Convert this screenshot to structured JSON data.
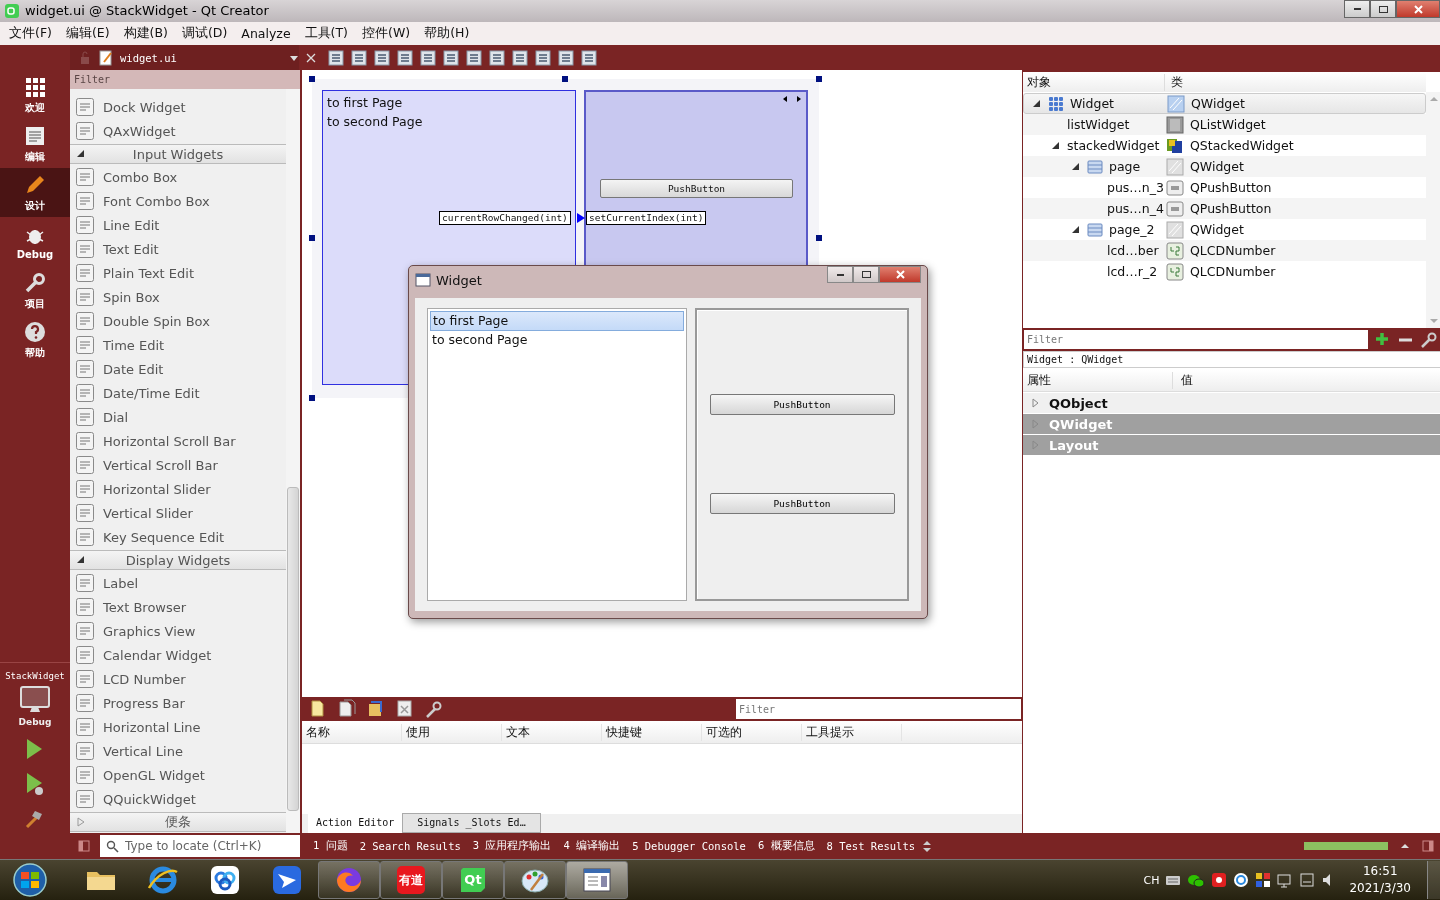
{
  "window": {
    "title": "widget.ui @ StackWidget - Qt Creator"
  },
  "menu": [
    "文件(F)",
    "编辑(E)",
    "构建(B)",
    "调试(D)",
    "Analyze",
    "工具(T)",
    "控件(W)",
    "帮助(H)"
  ],
  "editor_toolbar": {
    "file": "widget.ui"
  },
  "mode_bar": {
    "modes": [
      {
        "label": "欢迎",
        "selected": false
      },
      {
        "label": "编辑",
        "selected": false
      },
      {
        "label": "设计",
        "selected": true
      },
      {
        "label": "Debug",
        "selected": false
      },
      {
        "label": "项目",
        "selected": false
      },
      {
        "label": "帮助",
        "selected": false
      }
    ],
    "target": {
      "project": "StackWidget",
      "config": "Debug"
    }
  },
  "widget_box": {
    "filter": {
      "placeholder": "Filter"
    },
    "items": [
      {
        "kind": "widget",
        "label": "Dock Widget"
      },
      {
        "kind": "widget",
        "label": "QAxWidget"
      },
      {
        "kind": "category",
        "label": "Input Widgets",
        "expanded": true
      },
      {
        "kind": "widget",
        "label": "Combo Box"
      },
      {
        "kind": "widget",
        "label": "Font Combo Box"
      },
      {
        "kind": "widget",
        "label": "Line Edit"
      },
      {
        "kind": "widget",
        "label": "Text Edit"
      },
      {
        "kind": "widget",
        "label": "Plain Text Edit"
      },
      {
        "kind": "widget",
        "label": "Spin Box"
      },
      {
        "kind": "widget",
        "label": "Double Spin Box"
      },
      {
        "kind": "widget",
        "label": "Time Edit"
      },
      {
        "kind": "widget",
        "label": "Date Edit"
      },
      {
        "kind": "widget",
        "label": "Date/Time Edit"
      },
      {
        "kind": "widget",
        "label": "Dial"
      },
      {
        "kind": "widget",
        "label": "Horizontal Scroll Bar"
      },
      {
        "kind": "widget",
        "label": "Vertical Scroll Bar"
      },
      {
        "kind": "widget",
        "label": "Horizontal Slider"
      },
      {
        "kind": "widget",
        "label": "Vertical Slider"
      },
      {
        "kind": "widget",
        "label": "Key Sequence Edit"
      },
      {
        "kind": "category",
        "label": "Display Widgets",
        "expanded": true
      },
      {
        "kind": "widget",
        "label": "Label"
      },
      {
        "kind": "widget",
        "label": "Text Browser"
      },
      {
        "kind": "widget",
        "label": "Graphics View"
      },
      {
        "kind": "widget",
        "label": "Calendar Widget"
      },
      {
        "kind": "widget",
        "label": "LCD Number"
      },
      {
        "kind": "widget",
        "label": "Progress Bar"
      },
      {
        "kind": "widget",
        "label": "Horizontal Line"
      },
      {
        "kind": "widget",
        "label": "Vertical Line"
      },
      {
        "kind": "widget",
        "label": "OpenGL Widget"
      },
      {
        "kind": "widget",
        "label": "QQuickWidget"
      },
      {
        "kind": "category",
        "label": "便条",
        "expanded": false
      }
    ]
  },
  "form": {
    "list_items": [
      "to first Page",
      "to second Page"
    ],
    "button": "PushButton",
    "signal": "currentRowChanged(int)",
    "slot": "setCurrentIndex(int)"
  },
  "preview": {
    "title": "Widget",
    "list_items": [
      {
        "label": "to first Page",
        "selected": true
      },
      {
        "label": "to second Page",
        "selected": false
      }
    ],
    "buttons": [
      "PushButton",
      "PushButton"
    ]
  },
  "object_inspector": {
    "columns": [
      "对象",
      "类"
    ],
    "tree": [
      {
        "name": "Widget",
        "class": "QWidget",
        "kind": "form",
        "selected": true,
        "expanded": true,
        "children": [
          {
            "name": "listWidget",
            "class": "QListWidget",
            "kind": "list",
            "selected": false
          },
          {
            "name": "stackedWidget",
            "class": "QStackedWidget",
            "kind": "stack",
            "selected": false,
            "expanded": true,
            "children": [
              {
                "name": "page",
                "class": "QWidget",
                "kind": "page",
                "selected": false,
                "expanded": true,
                "children": [
                  {
                    "name": "pus…n_3",
                    "class": "QPushButton",
                    "kind": "button",
                    "selected": false
                  },
                  {
                    "name": "pus…n_4",
                    "class": "QPushButton",
                    "kind": "button",
                    "selected": false
                  }
                ]
              },
              {
                "name": "page_2",
                "class": "QWidget",
                "kind": "page",
                "selected": false,
                "expanded": true,
                "children": [
                  {
                    "name": "lcd…ber",
                    "class": "QLCDNumber",
                    "kind": "lcd",
                    "selected": false
                  },
                  {
                    "name": "lcd…r_2",
                    "class": "QLCDNumber",
                    "kind": "lcd",
                    "selected": false
                  }
                ]
              }
            ]
          }
        ]
      }
    ]
  },
  "property_editor": {
    "filter": {
      "placeholder": "Filter"
    },
    "context": "Widget : QWidget",
    "columns": [
      "属性",
      "值"
    ],
    "groups": [
      {
        "label": "QObject",
        "shaded": false,
        "expanded": false
      },
      {
        "label": "QWidget",
        "shaded": true,
        "expanded": false
      },
      {
        "label": "Layout",
        "shaded": true,
        "expanded": false
      }
    ]
  },
  "action_editor": {
    "filter": {
      "placeholder": "Filter"
    },
    "columns": [
      "名称",
      "使用",
      "文本",
      "快捷键",
      "可选的",
      "工具提示"
    ],
    "tabs": [
      {
        "label": "Action Editor",
        "selected": true
      },
      {
        "label": "Signals _Slots Ed…",
        "selected": false
      }
    ]
  },
  "status_bar": {
    "locate": {
      "placeholder": "Type to locate (Ctrl+K)"
    },
    "panes": [
      "1 问题",
      "2 Search Results",
      "3 应用程序输出",
      "4 编译输出",
      "5 Debugger Console",
      "6 概要信息",
      "8 Test Results"
    ],
    "progress": {
      "level": 1
    }
  },
  "taskbar": {
    "apps": [
      {
        "kind": "folder",
        "running": false,
        "selected": false
      },
      {
        "kind": "browser",
        "running": false,
        "selected": false
      },
      {
        "kind": "cloud",
        "running": false,
        "selected": false
      },
      {
        "kind": "bird",
        "running": false,
        "selected": false
      },
      {
        "kind": "fox",
        "running": true,
        "selected": false
      },
      {
        "kind": "dict",
        "text": "有道",
        "running": true,
        "selected": false
      },
      {
        "kind": "qt",
        "text": "Qt",
        "running": true,
        "selected": false
      },
      {
        "kind": "paint",
        "running": true,
        "selected": false
      },
      {
        "kind": "window",
        "running": true,
        "selected": true
      }
    ],
    "tray": {
      "language": "CH",
      "time": "16:51",
      "date": "2021/3/30"
    }
  }
}
